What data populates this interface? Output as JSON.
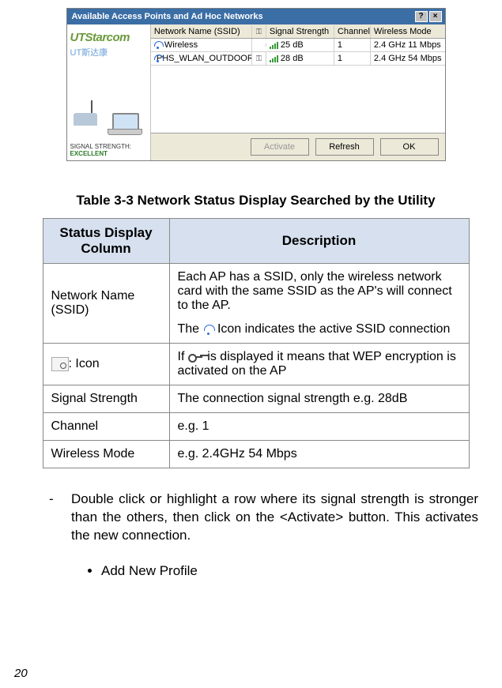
{
  "dialog": {
    "title": "Available Access Points and Ad Hoc Networks",
    "brand": "UTStarcom",
    "brand_cn": "UT斯达康",
    "signal_label": "SIGNAL STRENGTH:",
    "signal_value": "EXCELLENT",
    "columns": {
      "ssid": "Network Name (SSID)",
      "key": "",
      "signal": "Signal Strength",
      "channel": "Channel",
      "mode": "Wireless Mode"
    },
    "rows": [
      {
        "ssid": "Wireless",
        "has_key": false,
        "signal": "25 dB",
        "channel": "1",
        "mode": "2.4 GHz 11 Mbps"
      },
      {
        "ssid": "PHS_WLAN_OUTDOOR",
        "has_key": true,
        "signal": "28 dB",
        "channel": "1",
        "mode": "2.4 GHz 54 Mbps"
      }
    ],
    "buttons": {
      "activate": "Activate",
      "refresh": "Refresh",
      "ok": "OK"
    }
  },
  "caption": "Table 3-3  Network Status Display Searched by the Utility",
  "table": {
    "head_col": "Status Display Column",
    "head_desc": "Description",
    "rows": [
      {
        "col": "Network Name (SSID)",
        "desc1": "Each AP has a SSID, only the wireless network card with the same SSID as the AP's will connect to the AP.",
        "desc2a": "The ",
        "desc2b": " Icon indicates the active SSID connection"
      },
      {
        "col": ": Icon",
        "desc_a": "If ",
        "desc_b": " is displayed it means that WEP encryption is activated on the AP"
      },
      {
        "col": "Signal Strength",
        "desc": "The connection signal strength e.g. 28dB"
      },
      {
        "col": "Channel",
        "desc": "e.g. 1"
      },
      {
        "col": "Wireless Mode",
        "desc": "e.g. 2.4GHz 54 Mbps"
      }
    ]
  },
  "instruction": "Double click or highlight a row where its signal strength is stronger than the others, then click on the <Activate> button. This activates the new connection.",
  "bullet": "Add New Profile",
  "page_number": "20"
}
